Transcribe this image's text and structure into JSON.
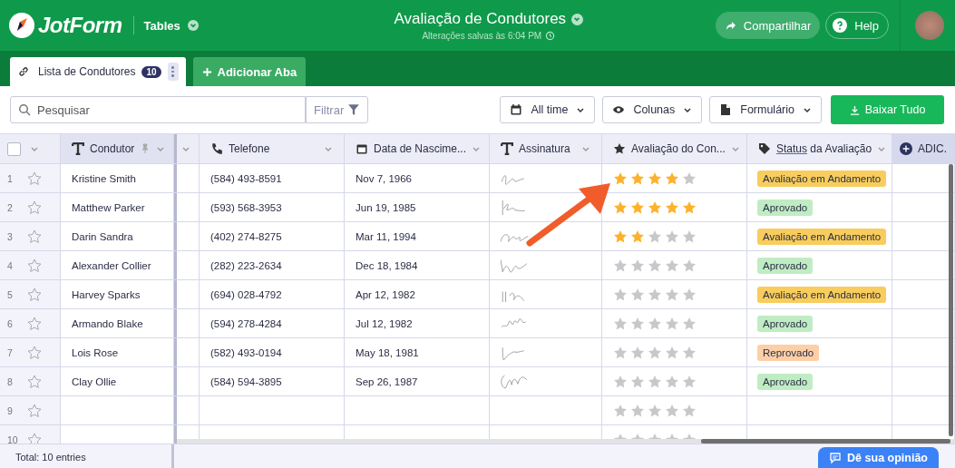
{
  "header": {
    "logo": "JotForm",
    "product": "Tables",
    "title": "Avaliação de Condutores",
    "saved": "Alterações salvas às 6:04 PM",
    "share": "Compartilhar",
    "help": "Help"
  },
  "tabs": [
    {
      "label": "Lista de Condutores",
      "count": "10",
      "selected": true
    }
  ],
  "add_tab": "Adicionar Aba",
  "toolbar": {
    "search": {
      "placeholder": "Pesquisar"
    },
    "filter": "Filtrar",
    "buttons": [
      {
        "label": "All time",
        "kind": "calendar"
      },
      {
        "label": "Colunas",
        "kind": "eye"
      },
      {
        "label": "Formulário",
        "kind": "document"
      }
    ],
    "download": "Baixar Tudo"
  },
  "table": {
    "select_all": {
      "checked": false
    },
    "columns": [
      {
        "label": "Condutor",
        "kind": "text",
        "pinned": true
      },
      {
        "label": "Telefone",
        "kind": "phone",
        "pinned": false
      },
      {
        "label": "Data de Nascime...",
        "kind": "date",
        "pinned": false
      },
      {
        "label": "Assinatura",
        "kind": "text",
        "pinned": false
      },
      {
        "label": "Avaliação do Con...",
        "kind": "rating",
        "pinned": false
      },
      {
        "link": "Status",
        "label": " da Avaliação",
        "kind": "tag",
        "pinned": false
      }
    ],
    "add_column": "ADIC.",
    "rows": [
      {
        "num": "1",
        "name": "Kristine Smith",
        "phone": "(584) 493-8591",
        "birth": "Nov 7, 1966",
        "signature": true,
        "stars": 4,
        "status": {
          "label": "Avaliação em Andamento",
          "color": "#f8cd5d"
        }
      },
      {
        "num": "2",
        "name": "Matthew Parker",
        "phone": "(593) 568-3953",
        "birth": "Jun 19, 1985",
        "signature": true,
        "stars": 5,
        "status": {
          "label": "Aprovado",
          "color": "#c0ecc3"
        }
      },
      {
        "num": "3",
        "name": "Darin Sandra",
        "phone": "(402) 274-8275",
        "birth": "Mar 11, 1994",
        "signature": true,
        "stars": 2,
        "status": {
          "label": "Avaliação em Andamento",
          "color": "#f8cd5d"
        }
      },
      {
        "num": "4",
        "name": "Alexander Collier",
        "phone": "(282) 223-2634",
        "birth": "Dec 18, 1984",
        "signature": true,
        "stars": 0,
        "status": {
          "label": "Aprovado",
          "color": "#c0ecc3"
        }
      },
      {
        "num": "5",
        "name": "Harvey Sparks",
        "phone": "(694) 028-4792",
        "birth": "Apr 12, 1982",
        "signature": true,
        "stars": 0,
        "status": {
          "label": "Avaliação em Andamento",
          "color": "#f8cd5d"
        }
      },
      {
        "num": "6",
        "name": "Armando Blake",
        "phone": "(594) 278-4284",
        "birth": "Jul 12, 1982",
        "signature": true,
        "stars": 0,
        "status": {
          "label": "Aprovado",
          "color": "#c0ecc3"
        }
      },
      {
        "num": "7",
        "name": "Lois Rose",
        "phone": "(582) 493-0194",
        "birth": "May 18, 1981",
        "signature": true,
        "stars": 0,
        "status": {
          "label": "Reprovado",
          "color": "#fdcfa6"
        }
      },
      {
        "num": "8",
        "name": "Clay Ollie",
        "phone": "(584) 594-3895",
        "birth": "Sep 26, 1987",
        "signature": true,
        "stars": 0,
        "status": {
          "label": "Aprovado",
          "color": "#c0ecc3"
        }
      },
      {
        "num": "9",
        "stars": 0
      },
      {
        "num": "10",
        "stars": 0
      }
    ]
  },
  "footer": {
    "total": "Total: 10 entries",
    "feedback": "Dê sua opinião"
  }
}
